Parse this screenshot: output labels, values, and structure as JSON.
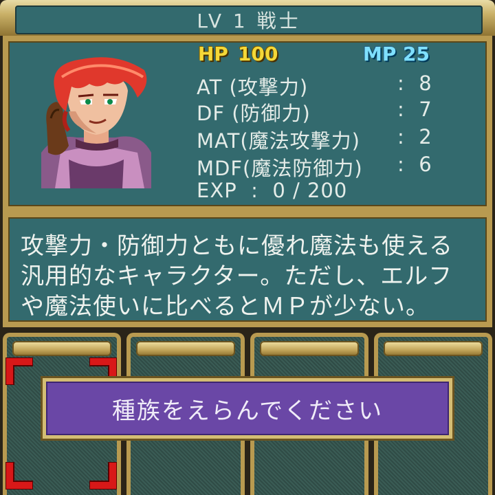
{
  "header": {
    "title": "LV 1  戦士"
  },
  "status": {
    "hp_label": "HP",
    "hp_value": "100",
    "mp_label": "MP",
    "mp_value": "25",
    "stats": [
      {
        "name": "AT (攻撃力)",
        "value": ":  8"
      },
      {
        "name": "DF (防御力)",
        "value": ":  7"
      },
      {
        "name": "MAT(魔法攻撃力)",
        "value": ":  2"
      },
      {
        "name": "MDF(魔法防御力)",
        "value": ":  6"
      }
    ],
    "exp_line": "EXP  :  0 / 200"
  },
  "description": {
    "lines": [
      "攻撃力・防御力ともに優れ魔法も使える",
      "汎用的なキャラクター。ただし、エルフ",
      "や魔法使いに比べるとＭＰが少ない。"
    ]
  },
  "prompt": {
    "text": "種族をえらんでください"
  },
  "colors": {
    "panel": "#336a6e",
    "frame_gold": "#b89a50",
    "prompt_purple": "#6a47a6",
    "hp_yellow": "#f4d838",
    "mp_cyan": "#7fe0ff",
    "cursor_red": "#d81818"
  }
}
